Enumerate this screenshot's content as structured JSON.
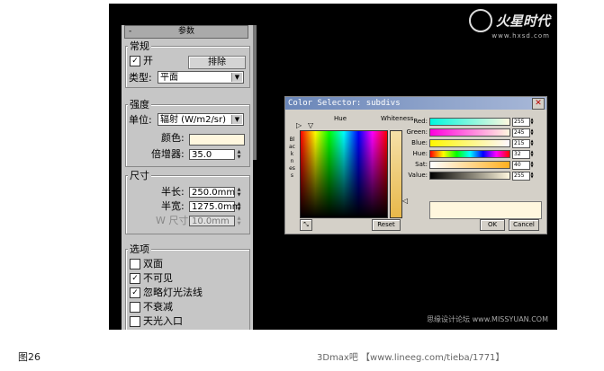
{
  "caption": "图26",
  "footer": "3Dmax吧 【www.lineeg.com/tieba/1771】",
  "logo": {
    "name": "火星时代",
    "url": "www.hxsd.com"
  },
  "watermark": "思缘设计论坛 www.MISSYUAN.COM",
  "panel": {
    "rollout_title": "参数",
    "rollout_minus": "-",
    "general": {
      "label": "常规",
      "on_label": "开",
      "on_checked": "✓",
      "exclude_button": "排除",
      "type_label": "类型:",
      "type_value": "平面"
    },
    "intensity": {
      "label": "强度",
      "units_label": "单位:",
      "units_value": "辐射 (W/m2/sr)",
      "color_label": "颜色:",
      "color_value": "#fff7de",
      "multiplier_label": "倍增器:",
      "multiplier_value": "35.0"
    },
    "size": {
      "label": "尺寸",
      "half_length_label": "半长:",
      "half_length_value": "250.0mm",
      "half_width_label": "半宽:",
      "half_width_value": "1275.0mm",
      "w_size_label": "W 尺寸",
      "w_size_value": "10.0mm"
    },
    "options": {
      "label": "选项",
      "items": [
        {
          "label": "双面",
          "check": ""
        },
        {
          "label": "不可见",
          "check": "✓"
        },
        {
          "label": "忽略灯光法线",
          "check": "✓"
        },
        {
          "label": "不衰减",
          "check": ""
        },
        {
          "label": "天光入口",
          "check": ""
        }
      ]
    }
  },
  "color_selector": {
    "title": "Color Selector: subdivs",
    "close": "✕",
    "hue_label": "Hue",
    "whiteness_label": "Whiteness",
    "blackness_label": "Blackness",
    "channels": [
      {
        "label": "Red:",
        "value": "255",
        "gradient": "linear-gradient(90deg,#00f7de,#fff7de)"
      },
      {
        "label": "Green:",
        "value": "245",
        "gradient": "linear-gradient(90deg,#ff00de,#fff7de)"
      },
      {
        "label": "Blue:",
        "value": "215",
        "gradient": "linear-gradient(90deg,#fff700,#fff7ff)"
      },
      {
        "label": "Hue:",
        "value": "32",
        "gradient": "linear-gradient(90deg,#f00,#ff0,#0f0,#0ff,#00f,#f0f,#f00)"
      },
      {
        "label": "Sat:",
        "value": "40",
        "gradient": "linear-gradient(90deg,#fff,#ffb020)"
      },
      {
        "label": "Value:",
        "value": "255",
        "gradient": "linear-gradient(90deg,#000,#fff7de)"
      }
    ],
    "reset_button": "Reset",
    "ok_button": "OK",
    "cancel_button": "Cancel",
    "preview_color": "#fff7de"
  }
}
